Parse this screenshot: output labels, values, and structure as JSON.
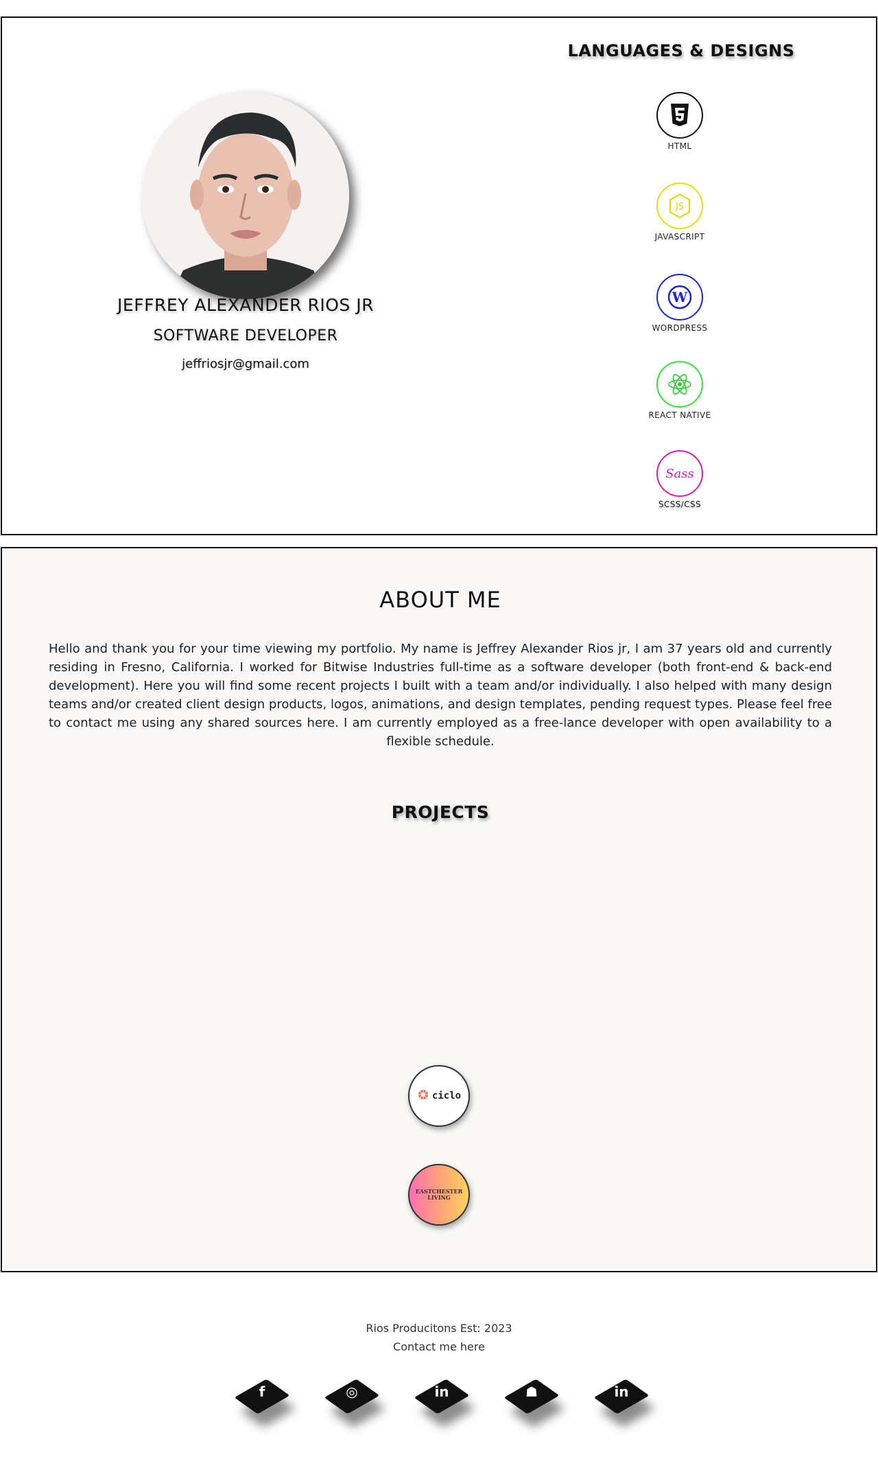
{
  "hero": {
    "name": "JEFFREY ALEXANDER RIOS JR",
    "role": "SOFTWARE DEVELOPER",
    "email": "jeffriosjr@gmail.com"
  },
  "languages": {
    "title": "LANGUAGES & DESIGNS",
    "items": [
      {
        "label": "HTML",
        "icon": "html5-icon",
        "color": "#111111"
      },
      {
        "label": "JAVASCRIPT",
        "icon": "javascript-icon",
        "color": "#e8e000"
      },
      {
        "label": "WORDPRESS",
        "icon": "wordpress-icon",
        "color": "#1c23d8"
      },
      {
        "label": "REACT NATIVE",
        "icon": "react-icon",
        "color": "#2ee82e"
      },
      {
        "label": "SCSS/CSS",
        "icon": "sass-icon",
        "color": "#e01ab0"
      }
    ]
  },
  "about": {
    "title": "ABOUT ME",
    "text": "Hello and thank you for your time viewing my portfolio. My name is Jeffrey Alexander Rios jr, I am 37 years old and currently residing in Fresno, California. I worked for Bitwise Industries full-time as a software developer (both front-end & back-end development). Here you will find some recent projects I built with a team and/or individually. I also helped with many design teams and/or created client design products, logos, animations, and design templates, pending request types. Please feel free to contact me using any shared sources here. I am currently employed as a free-lance developer with open availability to a flexible schedule."
  },
  "projects": {
    "title": "PROJECTS",
    "items": [
      {
        "label": "ciclo",
        "icon": "ciclo-logo"
      },
      {
        "label": "EASTCHESTER LIVING",
        "icon": "eastchester-logo"
      }
    ]
  },
  "footer": {
    "line1": "Rios Producitons Est: 2023",
    "line2": "Contact me here",
    "social": [
      {
        "icon": "facebook-icon",
        "glyph": "f"
      },
      {
        "icon": "instagram-icon",
        "glyph": "◎"
      },
      {
        "icon": "linkedin-icon",
        "glyph": "in"
      },
      {
        "icon": "github-icon",
        "glyph": "☗"
      },
      {
        "icon": "linkedin-icon",
        "glyph": "in"
      }
    ]
  }
}
